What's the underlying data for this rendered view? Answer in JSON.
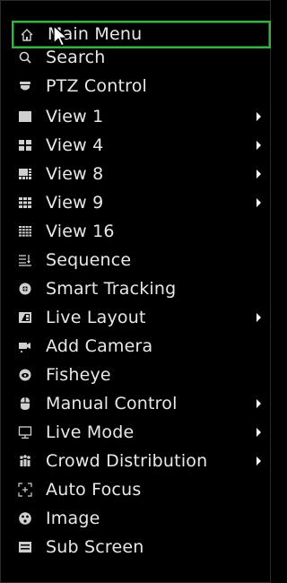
{
  "menu": {
    "items": [
      {
        "label": "Main Menu",
        "icon": "home-icon",
        "submenu": false,
        "selected": true
      },
      {
        "label": "Search",
        "icon": "search-icon",
        "submenu": false
      },
      {
        "label": "PTZ Control",
        "icon": "ptz-icon",
        "submenu": false
      },
      {
        "label": "View 1",
        "icon": "view-1-icon",
        "submenu": true
      },
      {
        "label": "View 4",
        "icon": "view-4-icon",
        "submenu": true
      },
      {
        "label": "View 8",
        "icon": "view-8-icon",
        "submenu": true
      },
      {
        "label": "View 9",
        "icon": "view-9-icon",
        "submenu": true
      },
      {
        "label": "View 16",
        "icon": "view-16-icon",
        "submenu": false
      },
      {
        "label": "Sequence",
        "icon": "sequence-icon",
        "submenu": false
      },
      {
        "label": "Smart Tracking",
        "icon": "smart-tracking-icon",
        "submenu": false
      },
      {
        "label": "Live Layout",
        "icon": "live-layout-icon",
        "submenu": true
      },
      {
        "label": "Add Camera",
        "icon": "add-camera-icon",
        "submenu": false
      },
      {
        "label": "Fisheye",
        "icon": "fisheye-icon",
        "submenu": false
      },
      {
        "label": "Manual Control",
        "icon": "manual-control-icon",
        "submenu": true
      },
      {
        "label": "Live Mode",
        "icon": "live-mode-icon",
        "submenu": true
      },
      {
        "label": "Crowd Distribution",
        "icon": "crowd-distribution-icon",
        "submenu": true
      },
      {
        "label": "Auto Focus",
        "icon": "auto-focus-icon",
        "submenu": false
      },
      {
        "label": "Image",
        "icon": "image-icon",
        "submenu": false
      },
      {
        "label": "Sub Screen",
        "icon": "sub-screen-icon",
        "submenu": false
      }
    ]
  },
  "colors": {
    "background": "#000000",
    "text": "#e8e8e8",
    "selected_border": "#38b043",
    "arrow": "#ffffff"
  }
}
